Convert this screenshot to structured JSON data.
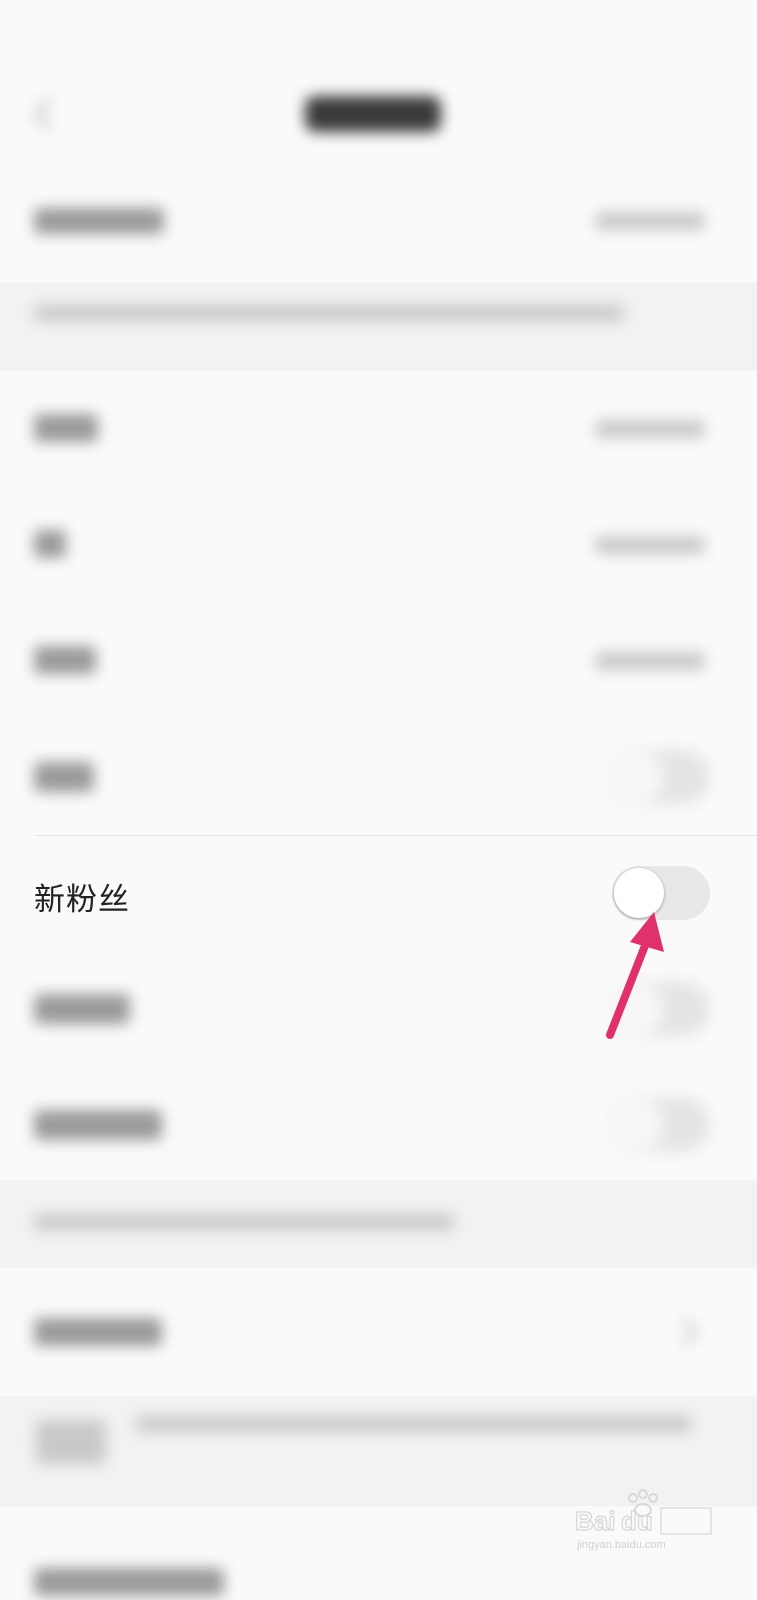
{
  "rows": {
    "new_fans": {
      "label": "新粉丝",
      "toggle_on": false
    }
  },
  "annotation": {
    "arrow_color": "#e0306e"
  }
}
